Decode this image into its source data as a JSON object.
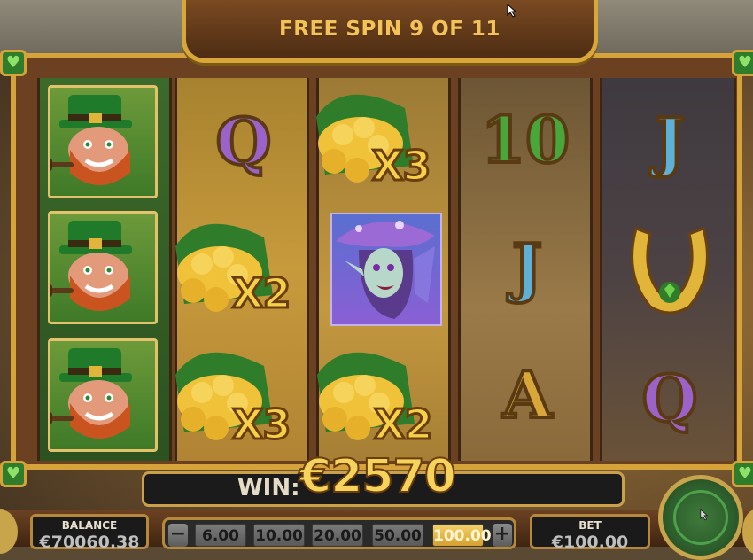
{
  "header": {
    "title": "FREE SPIN 9 OF 11"
  },
  "reels": {
    "reel1": {
      "symbols": [
        "leprechaun",
        "leprechaun",
        "leprechaun"
      ]
    },
    "reel2": {
      "symbols": [
        "Q",
        "pot-of-gold",
        "pot-of-gold"
      ],
      "multipliers": [
        "X2",
        "X3"
      ]
    },
    "reel3": {
      "symbols": [
        "pot-of-gold",
        "fairy",
        "pot-of-gold"
      ],
      "multipliers": [
        "X3",
        "X2"
      ]
    },
    "reel4": {
      "symbols": [
        "10",
        "J",
        "A"
      ]
    },
    "reel5": {
      "symbols": [
        "J",
        "horseshoe",
        "Q"
      ]
    }
  },
  "letters": {
    "r2_top": "Q",
    "r4_top": "10",
    "r4_mid": "J",
    "r4_bot": "A",
    "r5_top": "J",
    "r5_bot": "Q"
  },
  "multipliers": {
    "r3_top": "X3",
    "r2_mid": "X2",
    "r2_bot": "X3",
    "r3_bot": "X2"
  },
  "win": {
    "label": "WIN:",
    "value": "€2570"
  },
  "balance": {
    "label": "BALANCE",
    "value": "€70060.38"
  },
  "bet": {
    "label": "BET",
    "value": "€100.00",
    "options": [
      "6.00",
      "10.00",
      "20.00",
      "50.00",
      "100.00"
    ],
    "selected": "100.00",
    "minus": "−",
    "plus": "+"
  },
  "colors": {
    "gold": "#d9a63a",
    "win_text": "#f6d35a",
    "frame_brown": "#6b4122",
    "spin_green": "#2d5e2c"
  }
}
